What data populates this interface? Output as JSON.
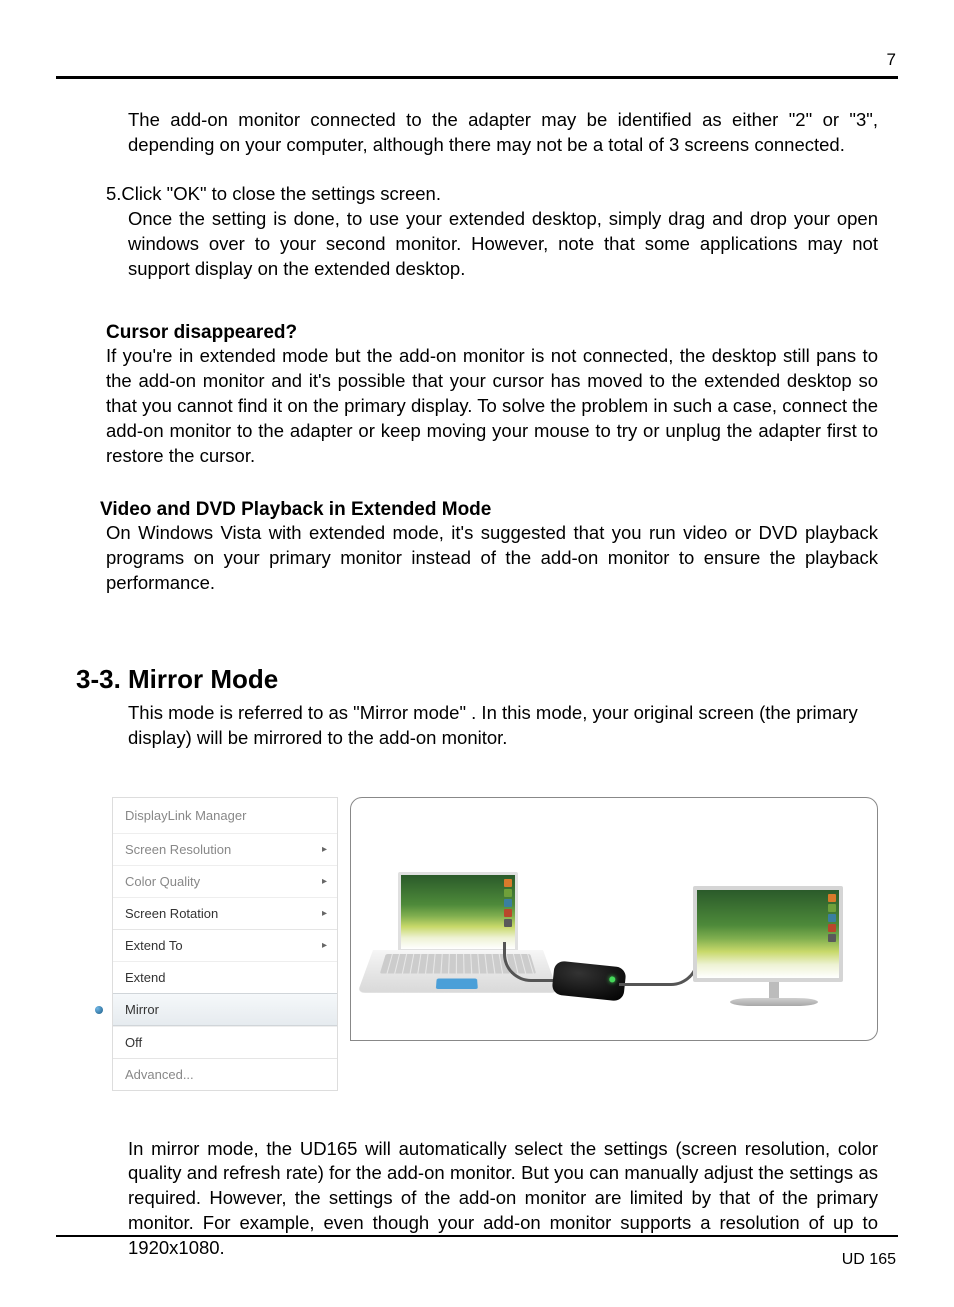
{
  "page_number": "7",
  "body": {
    "intro_para": "The add-on monitor connected to the adapter may be identified as either \"2\" or \"3\", depending on your computer, although there may not be a total of 3 screens connected.",
    "step5_head": "5.Click \"OK\" to close the settings screen.",
    "step5_body": "Once the setting is done, to use your extended desktop, simply drag and drop your open windows over to your second monitor. However, note that some applications may not support display on the extended desktop.",
    "cursor_head": "Cursor disappeared?",
    "cursor_body": "If you're in extended mode but the add-on monitor is not connected, the desktop still pans to the add-on monitor and it's possible that your cursor has moved to the extended desktop so that you cannot find it on the primary display. To solve the problem in such a case, connect the add-on monitor to the adapter or keep moving your mouse to try or unplug the adapter first to restore the cursor.",
    "video_head": "Video and DVD Playback in Extended Mode",
    "video_body": "On Windows Vista with extended mode, it's suggested that you run video or DVD playback programs on your primary monitor instead of the add-on monitor to ensure the playback performance.",
    "section_heading": "3-3. Mirror Mode",
    "mirror_intro": "This mode is referred to as \"Mirror mode\" . In this mode, your original screen (the primary display) will be mirrored to the add-on monitor.",
    "mirror_after": "In mirror mode, the UD165 will automatically select the settings (screen resolution, color quality and refresh rate) for the add-on monitor. But you can manually adjust the settings as required. However, the settings of the add-on monitor are limited by that of the primary monitor. For example, even though your add-on monitor supports a resolution of up to 1920x1080."
  },
  "menu": {
    "title": "DisplayLink Manager",
    "items": [
      {
        "label": "Screen Resolution",
        "submenu": true,
        "enabled": false
      },
      {
        "label": "Color Quality",
        "submenu": true,
        "enabled": false
      },
      {
        "label": "Screen Rotation",
        "submenu": true,
        "enabled": true
      },
      {
        "label": "Extend To",
        "submenu": true,
        "enabled": true
      },
      {
        "label": "Extend",
        "submenu": false,
        "enabled": true
      },
      {
        "label": "Mirror",
        "submenu": false,
        "enabled": true,
        "active": true
      },
      {
        "label": "Off",
        "submenu": false,
        "enabled": true
      },
      {
        "label": "Advanced...",
        "submenu": false,
        "enabled": false
      }
    ]
  },
  "footer": "UD 165"
}
